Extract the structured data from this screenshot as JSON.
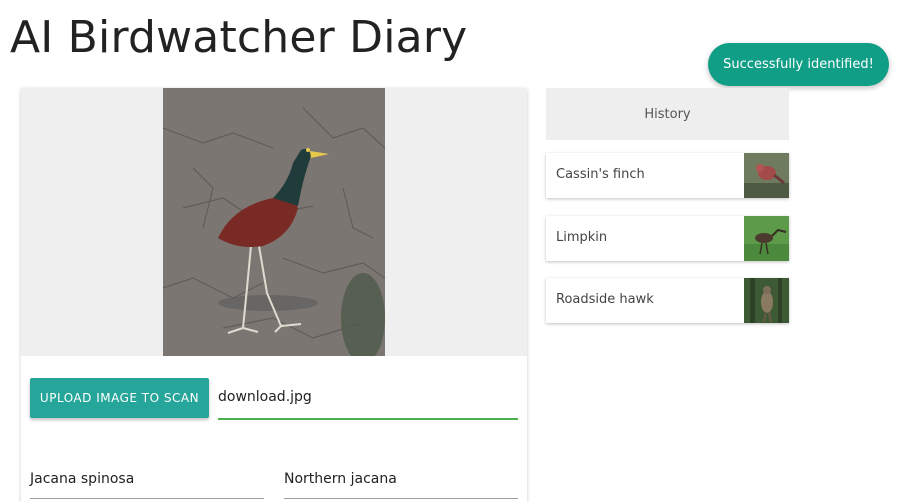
{
  "app": {
    "title": "AI Birdwatcher Diary"
  },
  "toast": {
    "message": "Successfully identified!"
  },
  "scanner": {
    "upload_button_label": "Upload image to scan",
    "file_name": "download.jpg",
    "scientific_name": "Jacana spinosa",
    "common_name": "Northern jacana"
  },
  "history": {
    "header": "History",
    "items": [
      {
        "label": "Cassin's finch",
        "thumb_icon": "finch-thumbnail"
      },
      {
        "label": "Limpkin",
        "thumb_icon": "limpkin-thumbnail"
      },
      {
        "label": "Roadside hawk",
        "thumb_icon": "hawk-thumbnail"
      }
    ]
  },
  "colors": {
    "accent": "#26a69a",
    "toast": "#119e86",
    "active_underline": "#4caf50"
  }
}
